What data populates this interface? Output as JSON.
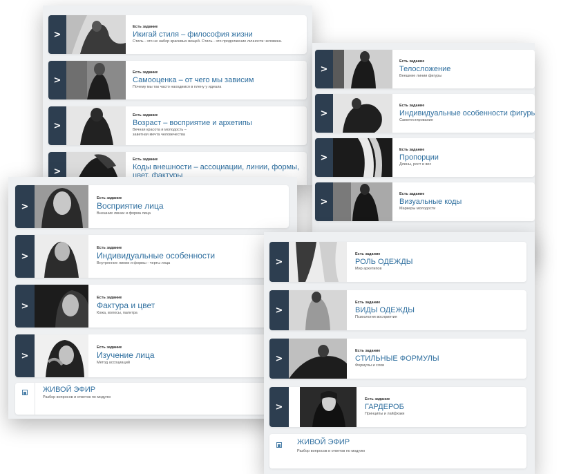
{
  "badge": "Есть задание",
  "panel1": {
    "cards": [
      {
        "title": "Икигай стиля – философия жизни",
        "sub": "Стиль - это не набор красивых вещей. Стиль - это продолжение личности человека.",
        "photo": "woman-crouching-photo"
      },
      {
        "title": "Самооценка – от чего мы зависим",
        "sub": "Почему мы так часто находимся в плену у идеала",
        "photo": "woman-dark-dress-photo"
      },
      {
        "title": "Возраст – восприятие и архетипы",
        "sub": "Вечная красота и молодость – заветная мечта человечества",
        "photo": "woman-back-photo"
      },
      {
        "title": "Коды внешности – ассоциации, линии, формы, цвет, фактуры",
        "sub": "",
        "photo": "woman-pose-photo"
      }
    ]
  },
  "panel2": {
    "cards": [
      {
        "title": "Телосложение",
        "sub": "Внешние линии фигуры",
        "photo": "woman-silhouette-photo"
      },
      {
        "title": "Индивидуальные особенности фигуры",
        "sub": "Самотестирование",
        "photo": "woman-curled-photo"
      },
      {
        "title": "Пропорции",
        "sub": "Длины, рост и вес",
        "photo": "woman-legs-photo"
      },
      {
        "title": "Визуальные коды",
        "sub": "Маркеры молодости",
        "photo": "woman-blazer-photo"
      }
    ]
  },
  "panel3": {
    "cards": [
      {
        "title": "Восприятие лица",
        "sub": "Внешние линии и форма лица",
        "photo": "face-portrait-photo"
      },
      {
        "title": "Индивидуальные особенности",
        "sub": "Внутренние линии и формы - черты лица",
        "photo": "face-profile-photo"
      },
      {
        "title": "Фактура и цвет",
        "sub": "Кожа, волосы, палитра",
        "photo": "face-closeup-photo"
      },
      {
        "title": "Изучение лица",
        "sub": "Метод ассоциаций",
        "photo": "face-hands-photo"
      }
    ],
    "live": {
      "title": "ЖИВОЙ ЭФИР",
      "sub": "Разбор вопросов и ответов по модулю"
    }
  },
  "panel4": {
    "cards": [
      {
        "title": "РОЛЬ ОДЕЖДЫ",
        "sub": "Мир архетипов",
        "photo": "coat-detail-photo"
      },
      {
        "title": "ВИДЫ ОДЕЖДЫ",
        "sub": "Психология восприятия",
        "photo": "nude-back-photo"
      },
      {
        "title": "СТИЛЬНЫЕ ФОРМУЛЫ",
        "sub": "Формулы и слои",
        "photo": "woman-reclining-photo"
      },
      {
        "title": "ГАРДЕРОБ",
        "sub": "Принципы и лайфхаки",
        "photo": "woman-turtleneck-photo"
      }
    ],
    "live": {
      "title": "ЖИВОЙ ЭФИР",
      "sub": "Разбор вопросов и ответов по модулю"
    }
  },
  "colors": {
    "arrow_bg": "#2d3e50",
    "title": "#2f6f9f",
    "panel_bg": "#eef0f2"
  }
}
